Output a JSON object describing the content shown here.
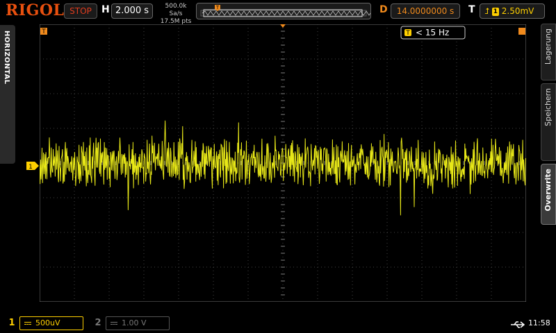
{
  "header": {
    "brand": "RIGOL",
    "run_status": "STOP",
    "horizontal_label": "H",
    "timebase": "2.000 s",
    "sample_rate": "500.0k Sa/s",
    "memory_depth": "17.5M pts",
    "delay_label": "D",
    "delay": "14.0000000 s",
    "trigger_label": "T",
    "trigger_channel": "1",
    "trigger_level": "2.50mV"
  },
  "side_left": {
    "label": "HORIZONTAL"
  },
  "side_right": {
    "tabs": [
      "Lagerung",
      "Speichern",
      "Overwrite"
    ],
    "active_tab": "Overwrite"
  },
  "screen": {
    "freq_counter_badge": "T",
    "freq_counter": "< 15 Hz",
    "trigger_pos_marker": "T",
    "ch1_marker": "1",
    "trace_color": "#e8e818",
    "grid_color": "#444444"
  },
  "footer": {
    "ch1": {
      "number": "1",
      "scale": "500uV",
      "color": "#ffd000"
    },
    "ch2": {
      "number": "2",
      "scale": "1.00 V"
    },
    "time": "11:58",
    "usb_icon": "usb-icon"
  },
  "colors": {
    "brand": "#e8500f",
    "stop": "#e03c1e",
    "delay": "#f08a1c",
    "trigger": "#ffd000"
  }
}
